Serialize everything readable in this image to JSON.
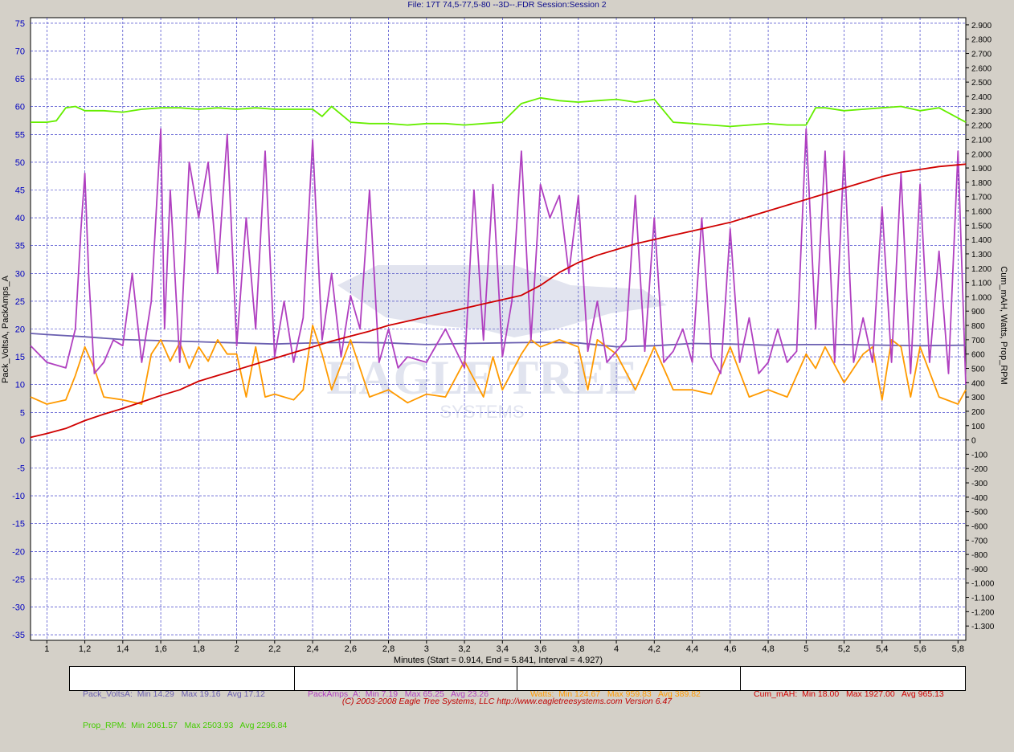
{
  "title": "File: 17T 74,5-77,5-80 --3D--.FDR   Session:Session 2",
  "footer": "(C) 2003-2008 Eagle Tree Systems, LLC      http://www.eagletreesystems.com      Version 6.47",
  "colors": {
    "volts": "#6a5fb0",
    "amps": "#b040c0",
    "watts": "#ff9a00",
    "mah": "#d00000",
    "rpm": "#66ee00",
    "grid": "#2020c0",
    "axis_text": "#0000c0"
  },
  "legend": {
    "volts": "Pack_VoltsA:  Min 14.29   Max 19.16   Avg 17.12",
    "rpm": "Prop_RPM:  Min 2061.57   Max 2503.93   Avg 2296.84",
    "amps": "PackAmps_A:  Min 7.19   Max 65.25   Avg 23.26",
    "watts": "Watts:  Min 124.67   Max 959.83   Avg 389.82",
    "mah": "Cum_mAH:  Min 18.00   Max 1927.00   Avg 965.13"
  },
  "chart_data": {
    "type": "line",
    "xlabel": "Minutes (Start = 0.914,  End = 5.841,  Interval =  4.927)",
    "ylabel_left": "Pack_VoltsA, PackAmps_A",
    "ylabel_right": "Cum_mAH, Watts, Prop_RPM",
    "xlim": [
      0.914,
      5.841
    ],
    "x_ticks": [
      "1",
      "1,2",
      "1,4",
      "1,6",
      "1,8",
      "2",
      "2,2",
      "2,4",
      "2,6",
      "2,8",
      "3",
      "3,2",
      "3,4",
      "3,6",
      "3,8",
      "4",
      "4,2",
      "4,4",
      "4,6",
      "4,8",
      "5",
      "5,2",
      "5,4",
      "5,6",
      "5,8"
    ],
    "ylim_left": [
      -36,
      76
    ],
    "left_ticks": [
      "75",
      "70",
      "65",
      "60",
      "55",
      "50",
      "45",
      "40",
      "35",
      "30",
      "25",
      "20",
      "15",
      "10",
      "5",
      "0",
      "-5",
      "-10",
      "-15",
      "-20",
      "-25",
      "-30",
      "-35"
    ],
    "ylim_right": [
      -1400,
      2950
    ],
    "right_ticks": [
      "2.900",
      "2.800",
      "2.700",
      "2.600",
      "2.500",
      "2.400",
      "2.300",
      "2.200",
      "2.100",
      "2.000",
      "1.900",
      "1.800",
      "1.700",
      "1.600",
      "1.500",
      "1.400",
      "1.300",
      "1.200",
      "1.100",
      "1.000",
      "900",
      "800",
      "700",
      "600",
      "500",
      "400",
      "300",
      "200",
      "100",
      "0",
      "-100",
      "-200",
      "-300",
      "-400",
      "-500",
      "-600",
      "-700",
      "-800",
      "-900",
      "-1.000",
      "-1.100",
      "-1.200",
      "-1.300"
    ],
    "series": [
      {
        "name": "Pack_VoltsA",
        "axis": "left",
        "x": [
          0.914,
          1.0,
          1.2,
          1.4,
          1.6,
          1.8,
          2.0,
          2.2,
          2.4,
          2.6,
          2.8,
          3.0,
          3.2,
          3.4,
          3.6,
          3.8,
          4.0,
          4.2,
          4.4,
          4.6,
          4.8,
          5.0,
          5.2,
          5.4,
          5.6,
          5.841
        ],
        "values": [
          19.2,
          19.0,
          18.6,
          18.1,
          17.9,
          17.7,
          17.5,
          17.3,
          17.5,
          17.6,
          17.5,
          17.2,
          17.4,
          17.5,
          17.6,
          17.5,
          16.8,
          17.0,
          17.4,
          17.3,
          17.1,
          17.2,
          17.2,
          17.1,
          17.0,
          17.1
        ]
      },
      {
        "name": "PackAmps_A",
        "axis": "left",
        "x": [
          0.914,
          1.0,
          1.1,
          1.15,
          1.18,
          1.2,
          1.22,
          1.25,
          1.3,
          1.35,
          1.4,
          1.45,
          1.5,
          1.55,
          1.6,
          1.62,
          1.65,
          1.7,
          1.75,
          1.8,
          1.85,
          1.9,
          1.95,
          2.0,
          2.05,
          2.1,
          2.15,
          2.2,
          2.25,
          2.3,
          2.35,
          2.4,
          2.45,
          2.5,
          2.55,
          2.6,
          2.65,
          2.7,
          2.75,
          2.8,
          2.85,
          2.9,
          3.0,
          3.1,
          3.2,
          3.25,
          3.3,
          3.35,
          3.4,
          3.45,
          3.5,
          3.55,
          3.6,
          3.65,
          3.7,
          3.75,
          3.8,
          3.85,
          3.9,
          3.95,
          4.0,
          4.05,
          4.1,
          4.15,
          4.2,
          4.25,
          4.3,
          4.35,
          4.4,
          4.45,
          4.5,
          4.55,
          4.6,
          4.65,
          4.7,
          4.75,
          4.8,
          4.85,
          4.9,
          4.95,
          5.0,
          5.05,
          5.1,
          5.15,
          5.2,
          5.25,
          5.3,
          5.35,
          5.4,
          5.45,
          5.5,
          5.55,
          5.6,
          5.65,
          5.7,
          5.75,
          5.8,
          5.841
        ],
        "values": [
          17,
          14,
          13,
          20,
          38,
          48,
          30,
          12,
          14,
          18,
          17,
          30,
          14,
          25,
          56,
          20,
          45,
          14,
          50,
          40,
          50,
          30,
          55,
          17,
          40,
          20,
          52,
          15,
          25,
          14,
          22,
          54,
          18,
          30,
          15,
          26,
          20,
          45,
          14,
          20,
          13,
          15,
          14,
          20,
          13,
          45,
          18,
          46,
          15,
          25,
          52,
          18,
          46,
          40,
          44,
          30,
          44,
          16,
          25,
          14,
          16,
          18,
          44,
          16,
          40,
          14,
          16,
          20,
          14,
          40,
          15,
          12,
          38,
          14,
          22,
          12,
          14,
          20,
          14,
          16,
          56,
          20,
          52,
          14,
          52,
          14,
          22,
          14,
          42,
          14,
          48,
          12,
          46,
          14,
          34,
          12,
          52,
          10
        ]
      },
      {
        "name": "Watts",
        "axis": "right",
        "x": [
          0.914,
          1.0,
          1.1,
          1.15,
          1.2,
          1.25,
          1.3,
          1.4,
          1.5,
          1.55,
          1.6,
          1.65,
          1.7,
          1.75,
          1.8,
          1.85,
          1.9,
          1.95,
          2.0,
          2.05,
          2.1,
          2.15,
          2.2,
          2.3,
          2.35,
          2.4,
          2.45,
          2.5,
          2.6,
          2.7,
          2.8,
          2.9,
          3.0,
          3.1,
          3.2,
          3.3,
          3.35,
          3.4,
          3.5,
          3.55,
          3.6,
          3.7,
          3.8,
          3.85,
          3.9,
          4.0,
          4.1,
          4.2,
          4.3,
          4.4,
          4.5,
          4.6,
          4.7,
          4.8,
          4.9,
          5.0,
          5.05,
          5.1,
          5.2,
          5.3,
          5.35,
          5.4,
          5.45,
          5.5,
          5.55,
          5.6,
          5.7,
          5.8,
          5.841
        ],
        "values": [
          300,
          250,
          280,
          450,
          650,
          500,
          300,
          280,
          250,
          600,
          700,
          550,
          680,
          500,
          650,
          550,
          700,
          600,
          600,
          300,
          650,
          300,
          320,
          280,
          350,
          800,
          600,
          350,
          700,
          300,
          350,
          260,
          320,
          300,
          550,
          300,
          580,
          350,
          600,
          700,
          650,
          700,
          650,
          350,
          700,
          600,
          350,
          650,
          350,
          350,
          320,
          650,
          300,
          350,
          300,
          600,
          500,
          650,
          400,
          600,
          650,
          280,
          700,
          650,
          300,
          650,
          300,
          250,
          350
        ]
      },
      {
        "name": "Cum_mAH",
        "axis": "right",
        "x": [
          0.914,
          1.0,
          1.1,
          1.2,
          1.3,
          1.4,
          1.5,
          1.6,
          1.7,
          1.8,
          1.9,
          2.0,
          2.1,
          2.2,
          2.3,
          2.4,
          2.5,
          2.6,
          2.7,
          2.8,
          2.9,
          3.0,
          3.1,
          3.2,
          3.3,
          3.4,
          3.5,
          3.6,
          3.7,
          3.8,
          3.9,
          4.0,
          4.1,
          4.2,
          4.3,
          4.4,
          4.5,
          4.6,
          4.7,
          4.8,
          4.9,
          5.0,
          5.1,
          5.2,
          5.3,
          5.4,
          5.5,
          5.6,
          5.7,
          5.841
        ],
        "values": [
          18,
          45,
          80,
          135,
          180,
          220,
          265,
          310,
          350,
          410,
          450,
          490,
          530,
          570,
          610,
          650,
          690,
          725,
          760,
          800,
          830,
          860,
          890,
          920,
          950,
          980,
          1010,
          1080,
          1170,
          1240,
          1290,
          1330,
          1370,
          1400,
          1430,
          1460,
          1490,
          1520,
          1560,
          1600,
          1640,
          1680,
          1720,
          1760,
          1800,
          1840,
          1870,
          1890,
          1910,
          1927
        ]
      },
      {
        "name": "Prop_RPM",
        "axis": "right",
        "x": [
          0.914,
          1.0,
          1.05,
          1.1,
          1.15,
          1.2,
          1.3,
          1.4,
          1.5,
          1.6,
          1.7,
          1.8,
          1.9,
          2.0,
          2.1,
          2.2,
          2.3,
          2.4,
          2.45,
          2.5,
          2.6,
          2.7,
          2.8,
          2.9,
          3.0,
          3.1,
          3.2,
          3.3,
          3.4,
          3.5,
          3.6,
          3.7,
          3.8,
          3.9,
          4.0,
          4.1,
          4.2,
          4.3,
          4.4,
          4.5,
          4.6,
          4.7,
          4.8,
          4.9,
          5.0,
          5.05,
          5.1,
          5.2,
          5.3,
          5.4,
          5.5,
          5.6,
          5.7,
          5.841
        ],
        "values": [
          2220,
          2220,
          2230,
          2320,
          2330,
          2300,
          2300,
          2290,
          2310,
          2320,
          2320,
          2310,
          2320,
          2310,
          2320,
          2310,
          2310,
          2310,
          2260,
          2330,
          2220,
          2210,
          2210,
          2200,
          2210,
          2210,
          2200,
          2210,
          2220,
          2350,
          2390,
          2370,
          2360,
          2370,
          2380,
          2360,
          2380,
          2220,
          2210,
          2200,
          2190,
          2200,
          2210,
          2200,
          2200,
          2320,
          2320,
          2300,
          2310,
          2320,
          2330,
          2300,
          2320,
          2220
        ]
      }
    ]
  }
}
